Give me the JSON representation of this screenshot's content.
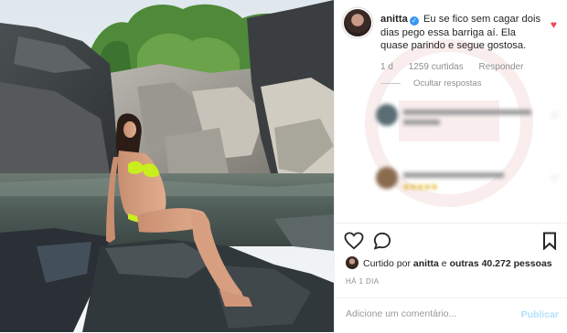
{
  "post": {
    "username": "anitta",
    "caption": "Eu se fico sem cagar dois dias pego essa barriga aí. Ela quase parindo e segue gostosa.",
    "time_ago": "1 d",
    "likes_on_comment": "1259 curtidas",
    "reply_label": "Responder",
    "hide_replies": "Ocultar respostas",
    "liked_by_prefix": "Curtido por ",
    "liked_by_user": "anitta",
    "liked_by_middle": " e ",
    "liked_by_others": "outras 40.272 pessoas",
    "date": "HÁ 1 DIA"
  },
  "comment_box": {
    "placeholder": "Adicione um comentário...",
    "publish_label": "Publicar"
  },
  "colors": {
    "accent_blue": "#3897f0",
    "heart_red": "#ed4956",
    "bikini": "#c8ee1e"
  }
}
